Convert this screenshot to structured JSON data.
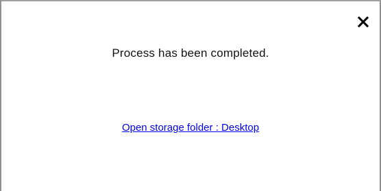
{
  "dialog": {
    "message": "Process has been completed.",
    "storage_link_label": "Open storage folder : Desktop",
    "close_icon": "close-icon"
  },
  "colors": {
    "link": "#0000ee",
    "text": "#111111",
    "border": "#909090"
  }
}
